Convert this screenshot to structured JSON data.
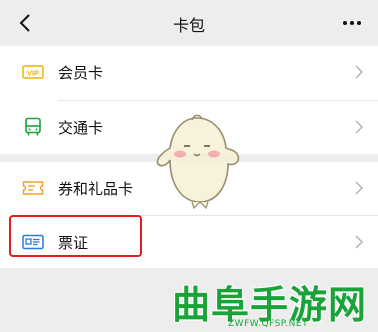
{
  "header": {
    "title": "卡包",
    "back_icon": "chevron-left-icon",
    "more_icon": "more-dots-icon"
  },
  "groups": [
    {
      "items": [
        {
          "label": "会员卡",
          "icon": "vip-card-icon",
          "icon_text": "VIP",
          "icon_color": "#f0b400"
        },
        {
          "label": "交通卡",
          "icon": "bus-icon",
          "icon_color": "#1aa339"
        }
      ]
    },
    {
      "items": [
        {
          "label": "券和礼品卡",
          "icon": "coupon-icon",
          "icon_color": "#f0a030"
        },
        {
          "label": "票证",
          "icon": "id-card-icon",
          "icon_color": "#2a7ae0"
        }
      ]
    }
  ],
  "annotation": {
    "highlight_color": "#e0201f"
  },
  "watermark": {
    "title": "曲阜手游网",
    "url": "ZWFW.QFSP.NET",
    "color": "#1aa339"
  }
}
